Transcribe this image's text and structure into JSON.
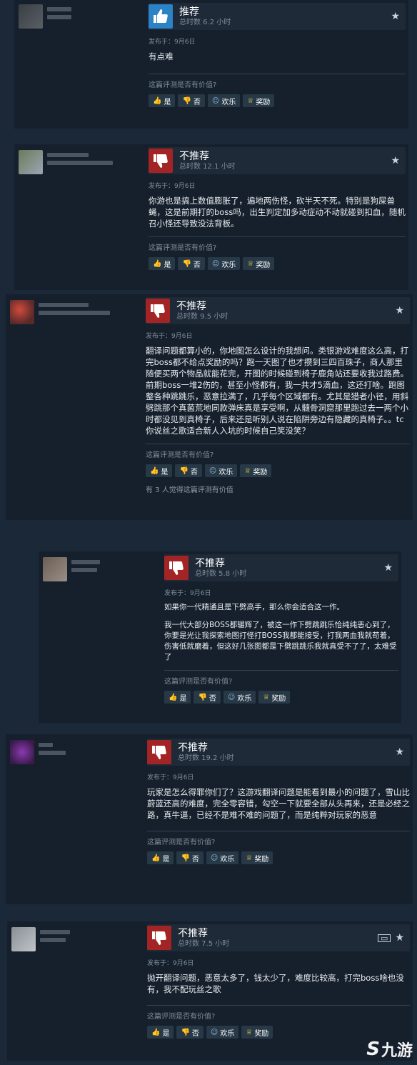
{
  "labels": {
    "posted": "发布于：9月6日",
    "question": "这篇评测是否有价值?",
    "yes": "是",
    "no": "否",
    "funny": "欢乐",
    "award": "奖励"
  },
  "reviews": [
    {
      "recommend": "推荐",
      "hours": "总时数 6.2 小时",
      "body": [
        "有点难"
      ],
      "helpful": ""
    },
    {
      "recommend": "不推荐",
      "hours": "总时数 12.1 小时",
      "body": [
        "你游也是搞上数值膨胀了，遍地两伤怪，砍半天不死。特别是狗屎兽蝇，这是前期打的boss吗，出生判定加多动症动不动就碰到扣血，随机召小怪还导致没法背板。"
      ],
      "helpful": ""
    },
    {
      "recommend": "不推荐",
      "hours": "总时数 9.5 小时",
      "body": [
        "翻译问题都算小的，你地图怎么设计的我想问。类银游戏难度这么高，打完boss都不给点奖励的吗？跑一天图了也才攒到三四百珠子，商人那里随便买两个物品就能花完，开图的时候碰到椅子鹿角站还要收我过路费。前期boss一堆2伤的，甚至小怪都有，我一共才5滴血，这还打啥。跑图整各种跳跳乐，恶意拉满了，几乎每个区域都有。尤其是猎者小径，用斜劈跳那个真菌荒地同款弹床真是享受啊，从髓骨洞窟那里跑过去一两个小时都没见到真椅子，后来还是听别人说在陷阱旁边有隐藏的真椅子。。tc你说丝之歌适合新人入坑的时候自己笑没笑？"
      ],
      "helpful": "有 3 人觉得这篇评测有价值"
    },
    {
      "recommend": "不推荐",
      "hours": "总时数 5.8 小时",
      "body": [
        "如果你一代精通且是下劈高手，那么你会适合这一作。",
        "我一代大部分BOSS都辗辉了，被这一作下劈跳跳乐恰纯纯恶心到了，你要是光让我探索地图打怪打BOSS我都能接受，打我两血我就苟着，伤害低就磨着，但这好几张图都是下劈跳跳乐我就真受不了了，太难受了"
      ],
      "helpful": ""
    },
    {
      "recommend": "不推荐",
      "hours": "总时数 19.2 小时",
      "body": [
        "玩家是怎么得罪你们了？这游戏翻译问题是能看到最小的问题了，雪山比蔚蓝还高的难度，完全零容错，勾空一下就要全部从头再来，还是必经之路，真牛逼，已经不是难不难的问题了，而是纯粹对玩家的恶意"
      ],
      "helpful": ""
    },
    {
      "recommend": "不推荐",
      "hours": "总时数 7.5 小时",
      "body": [
        "抛开翻译问题，恶意太多了，钱太少了，难度比较高，打完boss啥也没有，我不配玩丝之歌"
      ],
      "helpful": ""
    }
  ],
  "icons": {
    "thumb_up": "thumbs-up-icon",
    "thumb_down": "thumbs-down-icon",
    "star": "star-icon",
    "video": "video-icon"
  },
  "colors": {
    "recommend": "#2b82c4",
    "not_recommend": "#a32424",
    "background": "#1b2838",
    "card": "#16202d"
  },
  "watermark": {
    "mark": "S",
    "text": "九游"
  }
}
